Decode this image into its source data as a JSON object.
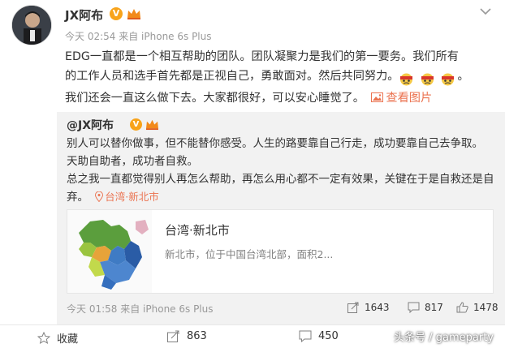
{
  "post": {
    "username": "JX阿布",
    "verified_badge": "V",
    "time": "今天 02:54",
    "source": "来自 iPhone 6s Plus",
    "text_line1": "EDG一直都是一个相互帮助的团队。团队凝聚力是我们的第一要务。我们所有",
    "text_line2": "的工作人员和选手首先都是正视自己，勇敢面对。然后共同努力。",
    "text_line2_end": "。",
    "text_line3": "我们还会一直这么做下去。大家都很好，可以安心睡觉了。",
    "view_pic_label": "查看图片",
    "emoji_icons": [
      "crying-face-emoji",
      "crying-face-emoji",
      "crying-face-emoji"
    ]
  },
  "repost": {
    "username": "@JX阿布",
    "verified_badge": "V",
    "lines": [
      "别人可以替你做事，但不能替你感受。人生的路要靠自己行走，成功要靠自己去争取。",
      "天助自助者，成功者自救。",
      "总之我一直都觉得别人再怎么帮助，再怎么用心都不一定有效果，关键在于是自救还是自"
    ],
    "last_line": "弃。",
    "location": "台湾·新北市",
    "card": {
      "title": "台湾·新北市",
      "description": "新北市，位于中国台湾北部，面积2..."
    },
    "time": "今天 01:58",
    "source": "来自 iPhone 6s Plus",
    "reposts": "1643",
    "comments": "817",
    "likes": "1478"
  },
  "actions": {
    "favorite_label": "收藏",
    "repost_count": "863",
    "comment_count": "450"
  },
  "watermark": "头条号 / gameparty",
  "colors": {
    "accent": "#eb7350",
    "vip_gold": "#f8a31a",
    "repost_bg": "#f2f2f2",
    "meta_gray": "#999999"
  }
}
